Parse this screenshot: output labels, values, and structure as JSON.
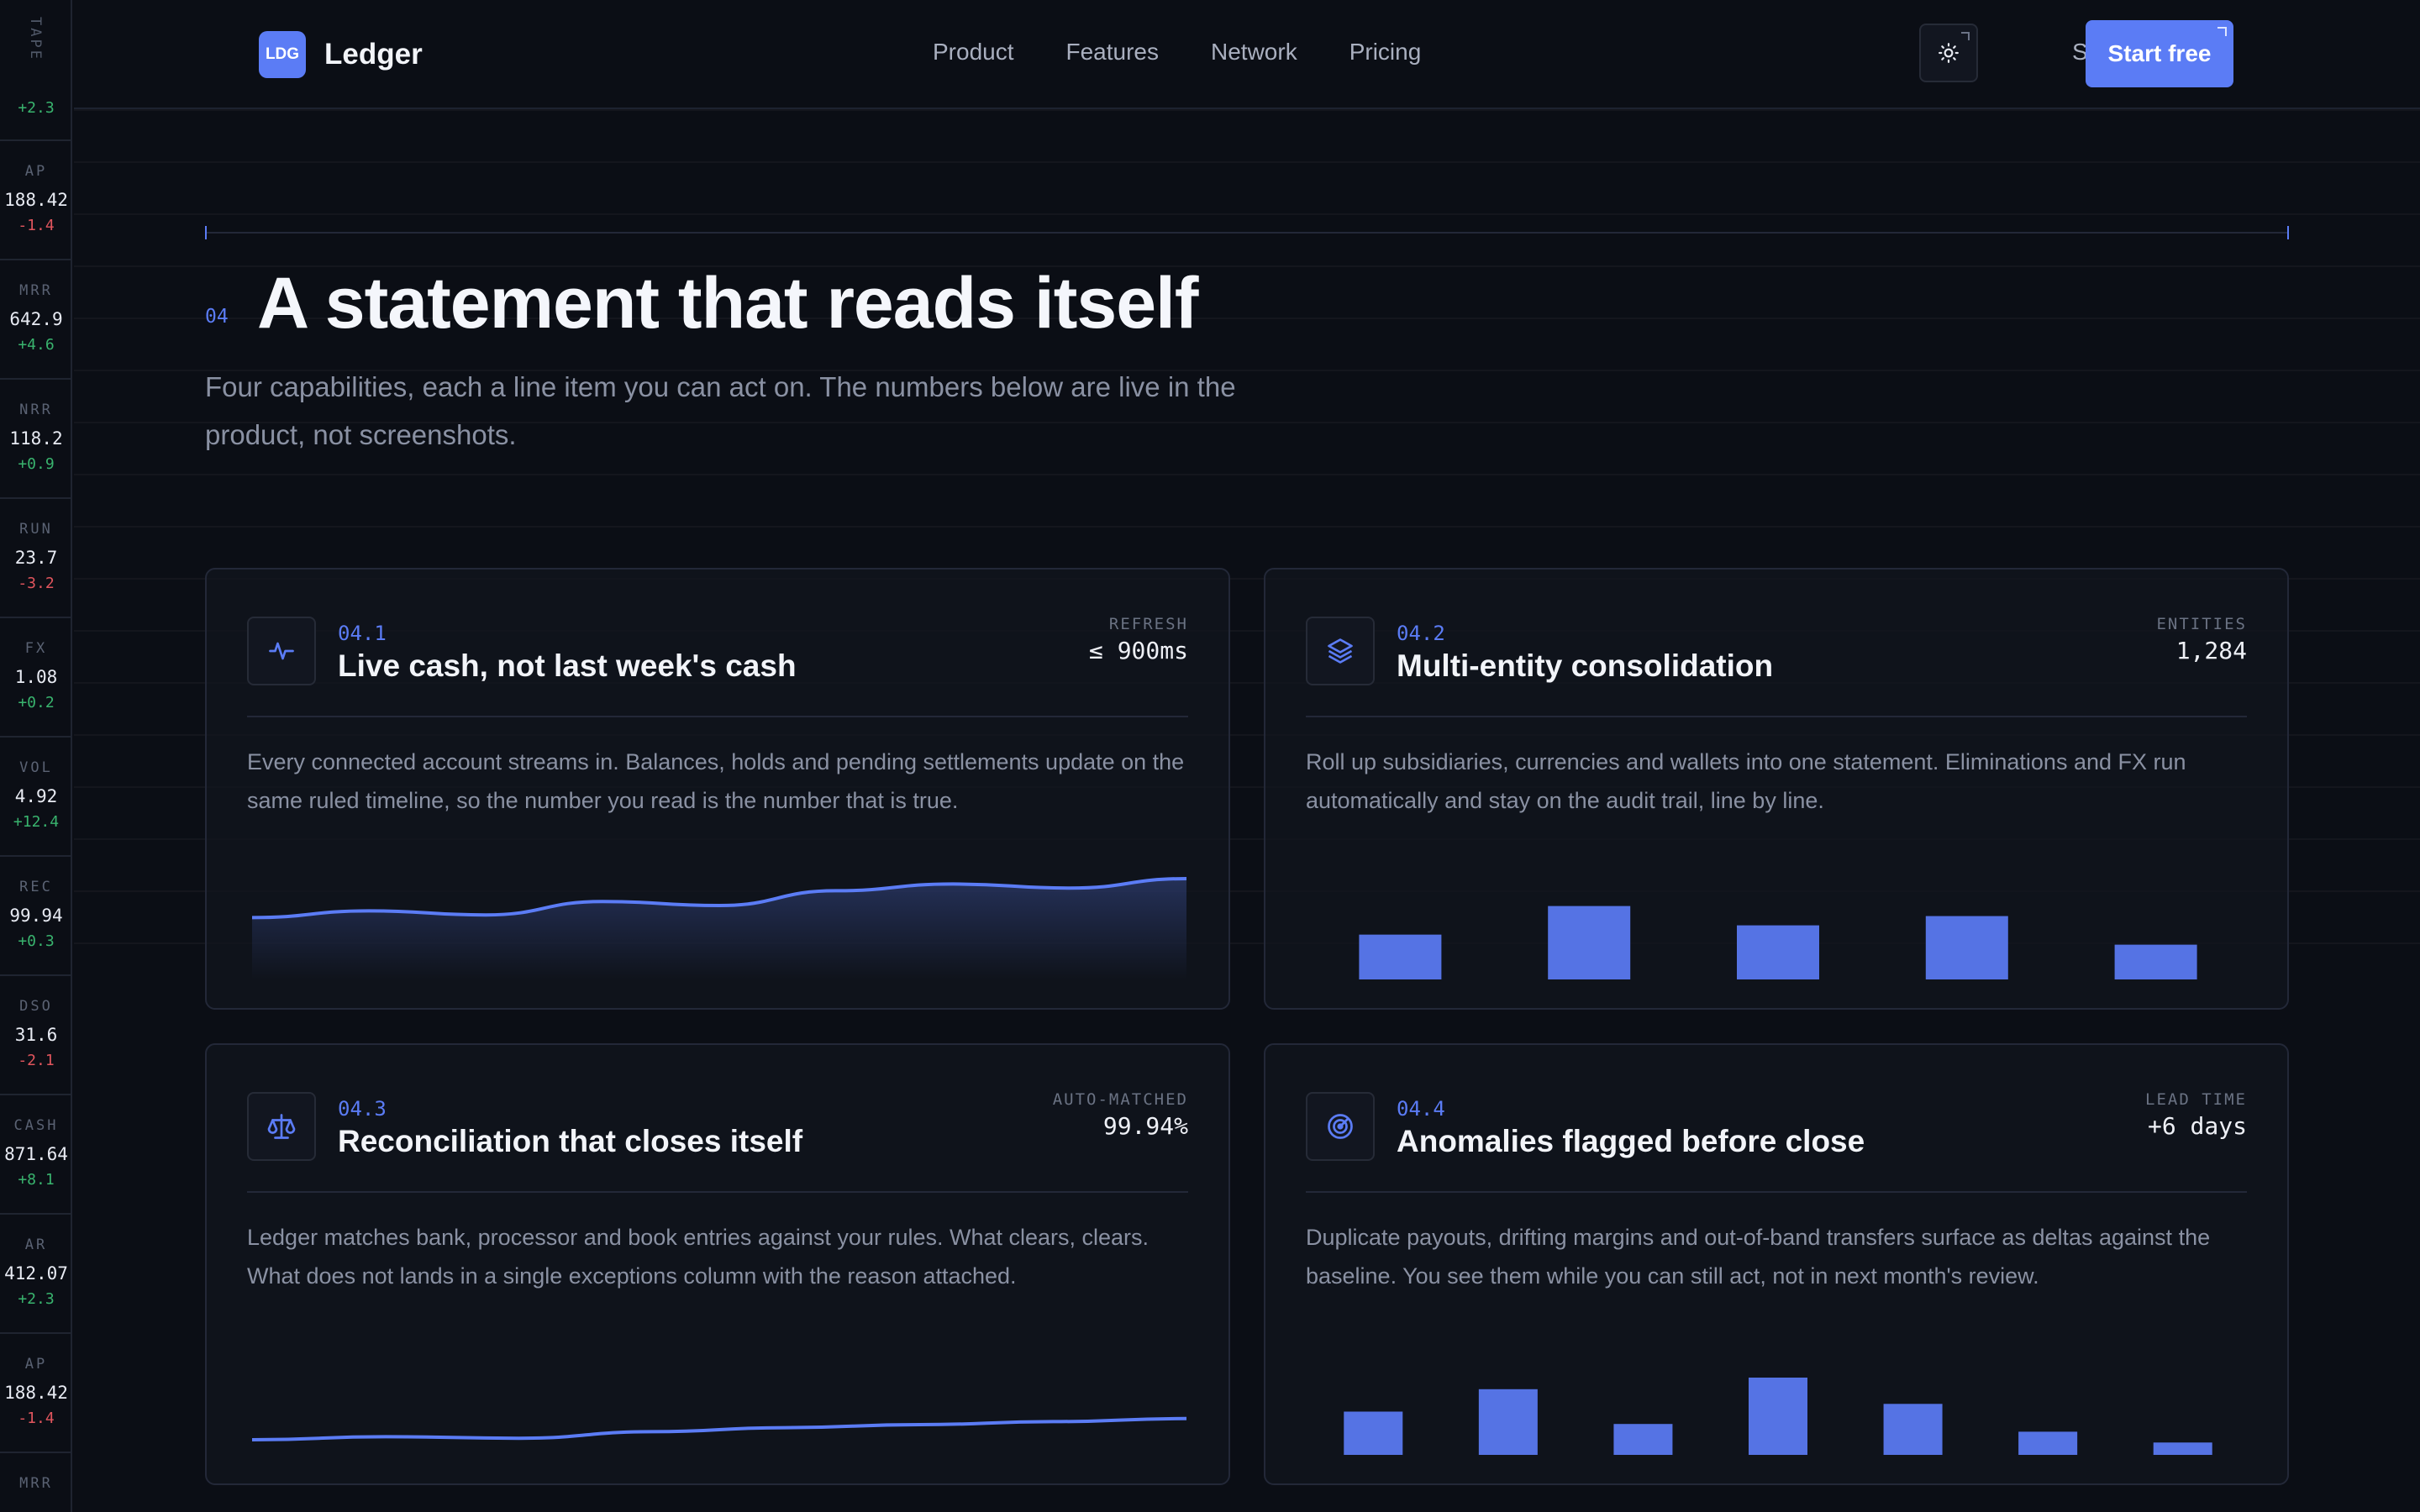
{
  "tape": {
    "label": "TAPE",
    "top_delta": "+2.3",
    "items": [
      {
        "label": "AP",
        "value": "188.42",
        "change": "-1.4",
        "dir": "down"
      },
      {
        "label": "MRR",
        "value": "642.9",
        "change": "+4.6",
        "dir": "up"
      },
      {
        "label": "NRR",
        "value": "118.2",
        "change": "+0.9",
        "dir": "up"
      },
      {
        "label": "RUN",
        "value": "23.7",
        "change": "-3.2",
        "dir": "down"
      },
      {
        "label": "FX",
        "value": "1.08",
        "change": "+0.2",
        "dir": "up"
      },
      {
        "label": "VOL",
        "value": "4.92",
        "change": "+12.4",
        "dir": "up"
      },
      {
        "label": "REC",
        "value": "99.94",
        "change": "+0.3",
        "dir": "up"
      },
      {
        "label": "DSO",
        "value": "31.6",
        "change": "-2.1",
        "dir": "down"
      },
      {
        "label": "CASH",
        "value": "871.64",
        "change": "+8.1",
        "dir": "up"
      },
      {
        "label": "AR",
        "value": "412.07",
        "change": "+2.3",
        "dir": "up"
      },
      {
        "label": "AP",
        "value": "188.42",
        "change": "-1.4",
        "dir": "down"
      },
      {
        "label": "MRR",
        "value": "",
        "change": "",
        "dir": "up"
      }
    ]
  },
  "header": {
    "logo_badge": "LDG",
    "logo_name": "Ledger",
    "nav": [
      "Product",
      "Features",
      "Network",
      "Pricing"
    ],
    "sign_in": "Sign in",
    "cta": "Start free"
  },
  "section": {
    "number": "04",
    "title": "A statement that reads itself",
    "subtitle": "Four capabilities, each a line item you can act on. The numbers below are live in the product, not screenshots."
  },
  "cards": [
    {
      "number": "04.1",
      "title": "Live cash, not last week's cash",
      "metric_label": "REFRESH",
      "metric_value": "≤ 900ms",
      "description": "Every connected account streams in. Balances, holds and pending settlements update on the same ruled timeline, so the number you read is the number that is true.",
      "icon": "pulse-icon"
    },
    {
      "number": "04.2",
      "title": "Multi-entity consolidation",
      "metric_label": "ENTITIES",
      "metric_value": "1,284",
      "description": "Roll up subsidiaries, currencies and wallets into one statement. Eliminations and FX run automatically and stay on the audit trail, line by line.",
      "icon": "layers-icon"
    },
    {
      "number": "04.3",
      "title": "Reconciliation that closes itself",
      "metric_label": "AUTO-MATCHED",
      "metric_value": "99.94%",
      "description": "Ledger matches bank, processor and book entries against your rules. What clears, clears. What does not lands in a single exceptions column with the reason attached.",
      "icon": "scale-icon"
    },
    {
      "number": "04.4",
      "title": "Anomalies flagged before close",
      "metric_label": "LEAD TIME",
      "metric_value": "+6 days",
      "description": "Duplicate payouts, drifting margins and out-of-band transfers surface as deltas against the baseline. You see them while you can still act, not in next month's review.",
      "icon": "radar-icon"
    }
  ],
  "colors": {
    "accent": "#5b7cf5",
    "background": "#0b0e15",
    "up": "#39b46e",
    "down": "#e0555d"
  },
  "chart_data": [
    {
      "type": "area",
      "values": [
        0.42,
        0.52,
        0.46,
        0.66,
        0.6,
        0.82,
        0.92,
        0.86,
        1.0
      ]
    },
    {
      "type": "bar",
      "values": [
        0.58,
        0.95,
        0.7,
        0.82,
        0.45
      ]
    },
    {
      "type": "line",
      "values": [
        0.3,
        0.36,
        0.33,
        0.46,
        0.54,
        0.6,
        0.66,
        0.72
      ]
    },
    {
      "type": "bar",
      "values": [
        0.56,
        0.85,
        0.4,
        1.0,
        0.66,
        0.3,
        0.16
      ]
    }
  ]
}
